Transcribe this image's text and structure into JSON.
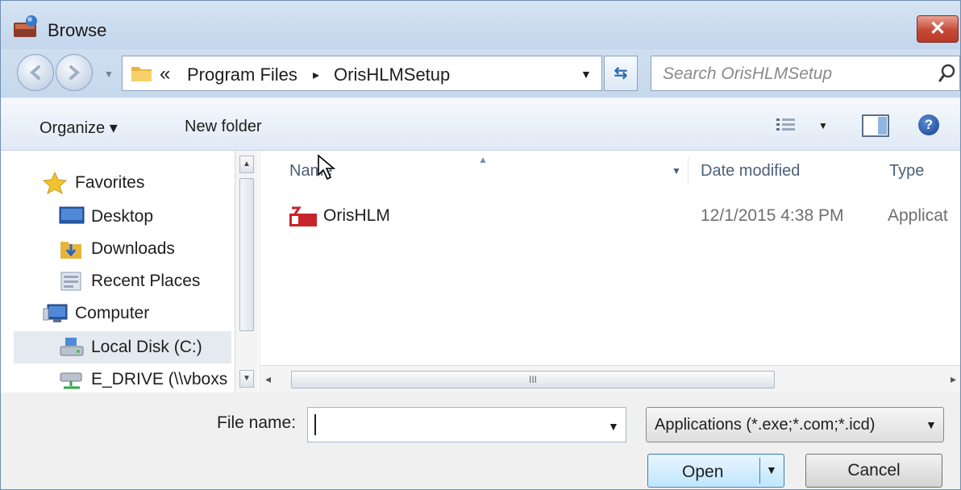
{
  "window": {
    "title": "Browse",
    "close_label": "✕"
  },
  "address": {
    "overflow_chevron": "«",
    "segments": [
      "Program Files",
      "OrisHLMSetup"
    ],
    "separator": "▸",
    "search_placeholder": "Search OrisHLMSetup"
  },
  "toolbar": {
    "organize_label": "Organize ▾",
    "new_folder_label": "New folder"
  },
  "nav_pane": {
    "items": [
      {
        "label": "Favorites",
        "icon": "star-icon"
      },
      {
        "label": "Desktop",
        "icon": "desktop-icon"
      },
      {
        "label": "Downloads",
        "icon": "downloads-icon"
      },
      {
        "label": "Recent Places",
        "icon": "recent-places-icon"
      },
      {
        "label": "Computer",
        "icon": "computer-icon"
      },
      {
        "label": "Local Disk (C:)",
        "icon": "drive-icon"
      },
      {
        "label": "E_DRIVE (\\\\vboxs",
        "icon": "network-drive-icon"
      }
    ],
    "selected_index": 5
  },
  "file_list": {
    "columns": [
      "Name",
      "Date modified",
      "Type"
    ],
    "rows": [
      {
        "name": "OrisHLM",
        "date": "12/1/2015 4:38 PM",
        "type": "Applicat",
        "icon": "app-icon"
      }
    ],
    "hscroll_grip": "III"
  },
  "bottom": {
    "file_name_label": "File name:",
    "file_name_value": "",
    "file_type": "Applications (*.exe;*.com;*.icd)",
    "open_label": "Open",
    "cancel_label": "Cancel"
  },
  "colors": {
    "title_bar": "#c9dbef",
    "close_button": "#c44a35",
    "selection": "#e5eaf0",
    "open_button": "#bee6fd"
  }
}
